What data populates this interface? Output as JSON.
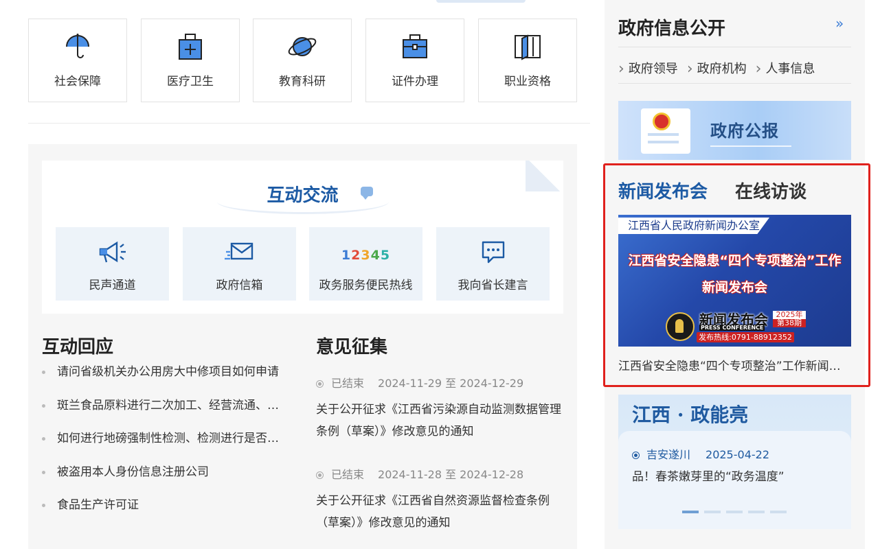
{
  "services": [
    {
      "label": "社会保障",
      "icon": "umbrella-icon"
    },
    {
      "label": "医疗卫生",
      "icon": "medical-kit-icon"
    },
    {
      "label": "教育科研",
      "icon": "planet-icon"
    },
    {
      "label": "证件办理",
      "icon": "briefcase-icon"
    },
    {
      "label": "职业资格",
      "icon": "book-icon"
    }
  ],
  "interaction": {
    "title": "互动交流",
    "boxes": [
      {
        "label": "民声通道",
        "icon": "megaphone-icon"
      },
      {
        "label": "政府信箱",
        "icon": "mail-icon"
      },
      {
        "label": "政务服务便民热线",
        "hotline": [
          "1",
          "2",
          "3",
          "4",
          "5"
        ]
      },
      {
        "label": "我向省长建言",
        "icon": "chat-bubble-icon"
      }
    ],
    "hotline_colors": [
      "#3b7bd4",
      "#e24b3b",
      "#f0a52a",
      "#4aa84a",
      "#2bb0a8"
    ]
  },
  "responses": {
    "title": "互动回应",
    "items": [
      "请问省级机关办公用房大中修项目如何申请",
      "斑兰食品原料进行二次加工、经营流通、销售",
      "如何进行地磅强制性检测、检测进行是否收费",
      "被盗用本人身份信息注册公司",
      "食品生产许可证"
    ]
  },
  "opinions": {
    "title": "意见征集",
    "items": [
      {
        "status": "已结束",
        "date": "2024-11-29 至 2024-12-29",
        "text": "关于公开征求《江西省污染源自动监测数据管理条例（草案）》修改意见的通知"
      },
      {
        "status": "已结束",
        "date": "2024-11-28 至 2024-12-28",
        "text": "关于公开征求《江西省自然资源监督检查条例（草案）》修改意见的通知"
      }
    ]
  },
  "gov_info": {
    "title": "政府信息公开",
    "more": "»",
    "links": [
      "政府领导",
      "政府机构",
      "人事信息"
    ]
  },
  "bulletin": {
    "label": "政府公报"
  },
  "press": {
    "tabs": [
      "新闻发布会",
      "在线访谈"
    ],
    "active_color": "#1c5aa4",
    "office": "江西省人民政府新闻办公室",
    "headline_1": "江西省安全隐患“四个专项整治”工作",
    "headline_2": "新闻发布会",
    "badge_cn": "新闻发布会",
    "badge_en": "PRESS CONFERENCE",
    "year": "2025年",
    "issue": "第38期",
    "hotline": "发布热线:0791-88912352",
    "caption": "江西省安全隐患“四个专项整治”工作新闻发布会"
  },
  "jx_power": {
    "title": "江西 · 政能亮",
    "source": "吉安遂川",
    "date": "2025-04-22",
    "text": "品！春茶嫩芽里的“政务温度”",
    "dots": 5,
    "active_dot": 0
  }
}
